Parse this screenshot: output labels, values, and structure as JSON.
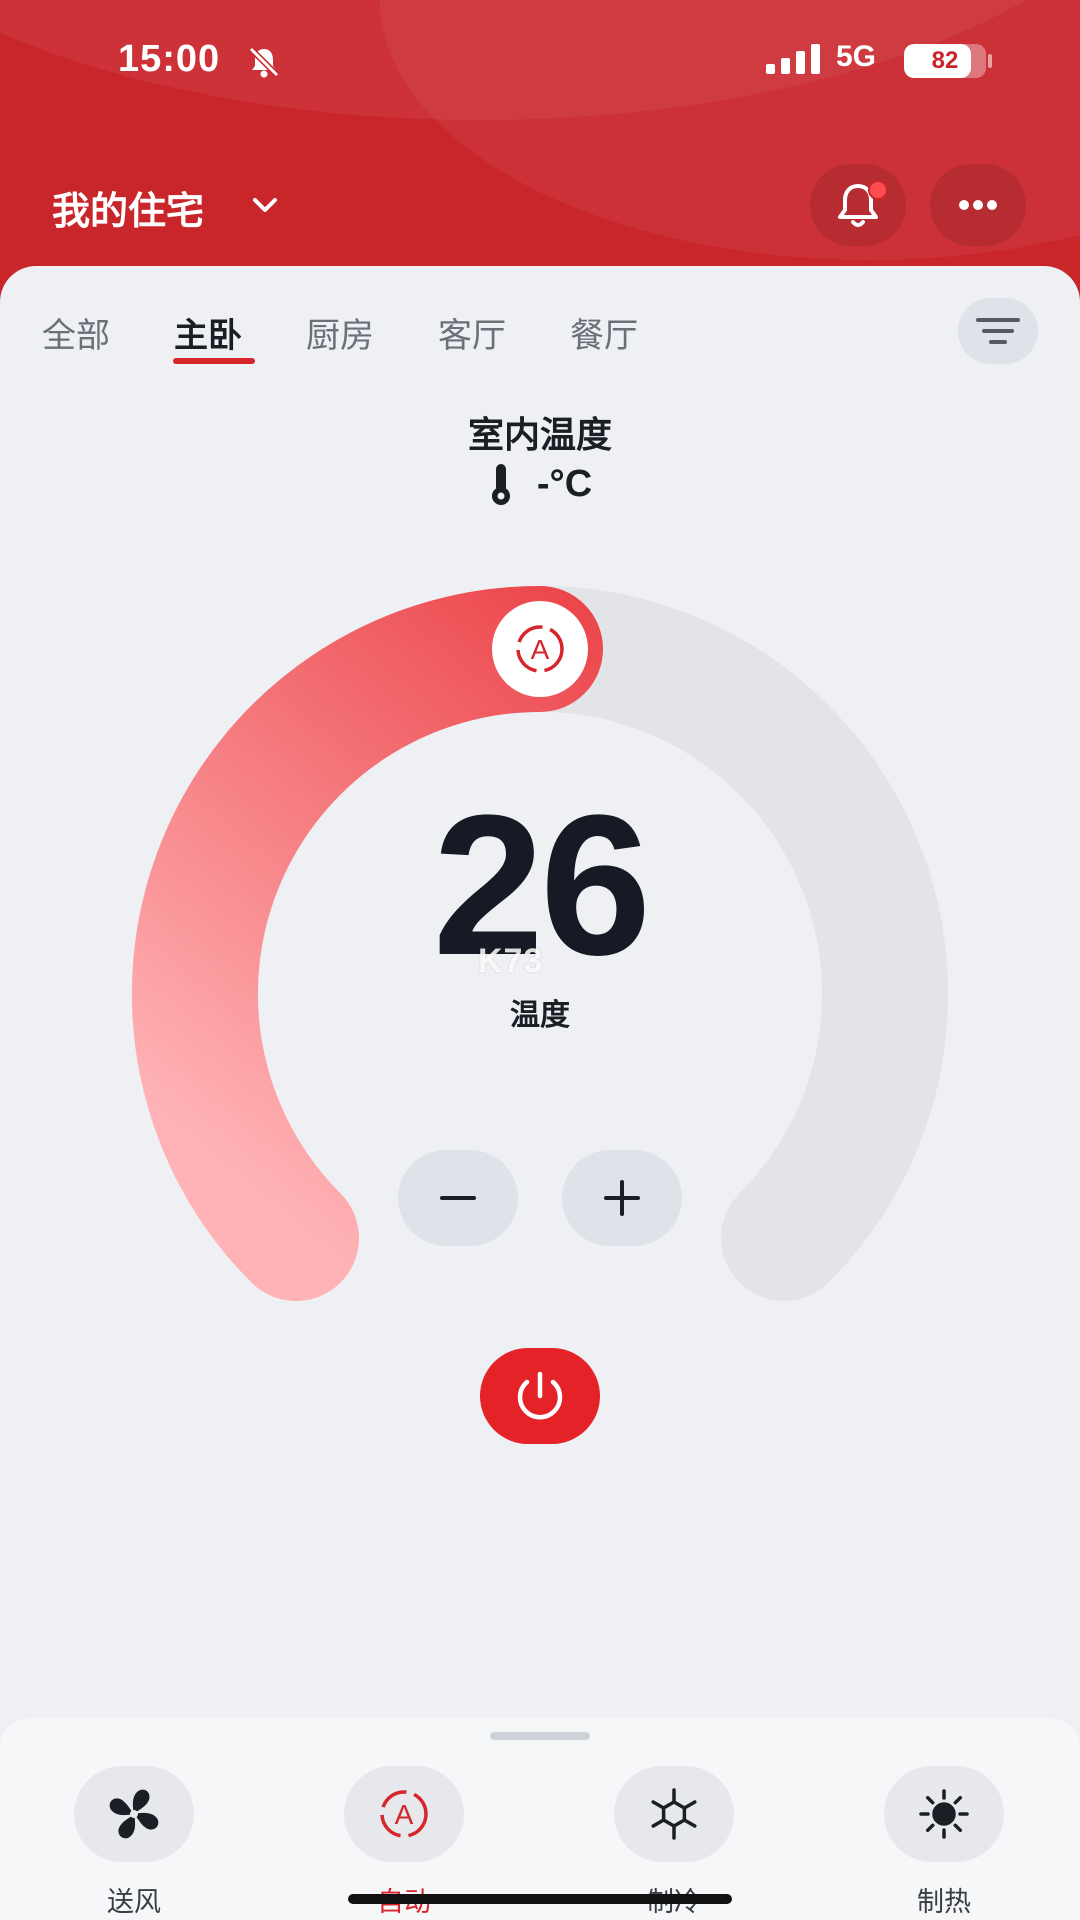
{
  "status_bar": {
    "time": "15:00",
    "network": "5G",
    "battery_level": 82,
    "battery_text": "82"
  },
  "header": {
    "home_title": "我的住宅"
  },
  "tabs": [
    {
      "label": "全部"
    },
    {
      "label": "主卧"
    },
    {
      "label": "厨房"
    },
    {
      "label": "客厅"
    },
    {
      "label": "餐厅"
    }
  ],
  "active_tab": "主卧",
  "indoor": {
    "label": "室内温度",
    "value": "-°C"
  },
  "dial": {
    "set_temperature": "26",
    "temperature_label": "温度",
    "level_fraction": 0.5,
    "watermark": "K73"
  },
  "modes": [
    {
      "label": "送风",
      "icon": "fan-icon"
    },
    {
      "label": "自动",
      "icon": "auto-mode-icon"
    },
    {
      "label": "制冷",
      "icon": "snowflake-icon"
    },
    {
      "label": "制热",
      "icon": "sun-icon"
    }
  ],
  "active_mode": "自动",
  "colors": {
    "brand_red": "#c9262c",
    "accent_red": "#e52227",
    "arc_start": "#ffb3b6",
    "arc_end": "#e52227",
    "arc_track": "#e3e4e7",
    "text_dark": "#1b1e25"
  }
}
